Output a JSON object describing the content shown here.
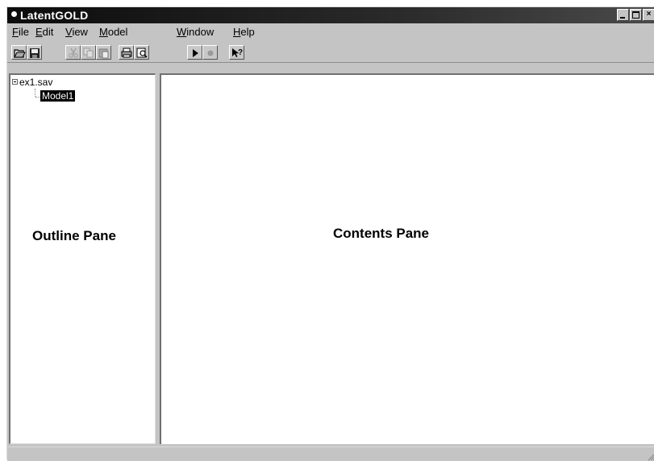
{
  "window": {
    "title": "LatentGOLD"
  },
  "menu": {
    "items": [
      {
        "prefix": "",
        "accel": "F",
        "rest": "ile"
      },
      {
        "prefix": "",
        "accel": "E",
        "rest": "dit"
      },
      {
        "prefix": "",
        "accel": "V",
        "rest": "iew"
      },
      {
        "prefix": "",
        "accel": "M",
        "rest": "odel"
      },
      {
        "prefix": "",
        "accel": "W",
        "rest": "indow"
      },
      {
        "prefix": "",
        "accel": "H",
        "rest": "elp"
      }
    ]
  },
  "toolbar": {
    "buttons": [
      "open-icon",
      "save-icon",
      "cut-icon",
      "copy-icon",
      "paste-icon",
      "print-icon",
      "print-preview-icon",
      "run-icon",
      "stop-icon",
      "context-help-icon"
    ]
  },
  "outline": {
    "root_label": "ex1.sav",
    "child_label": "Model1",
    "pane_label": "Outline Pane"
  },
  "contents": {
    "pane_label": "Contents Pane"
  },
  "colors": {
    "titlebar": "#1a1a1a",
    "chrome": "#c4c4c4",
    "selection": "#000000"
  }
}
